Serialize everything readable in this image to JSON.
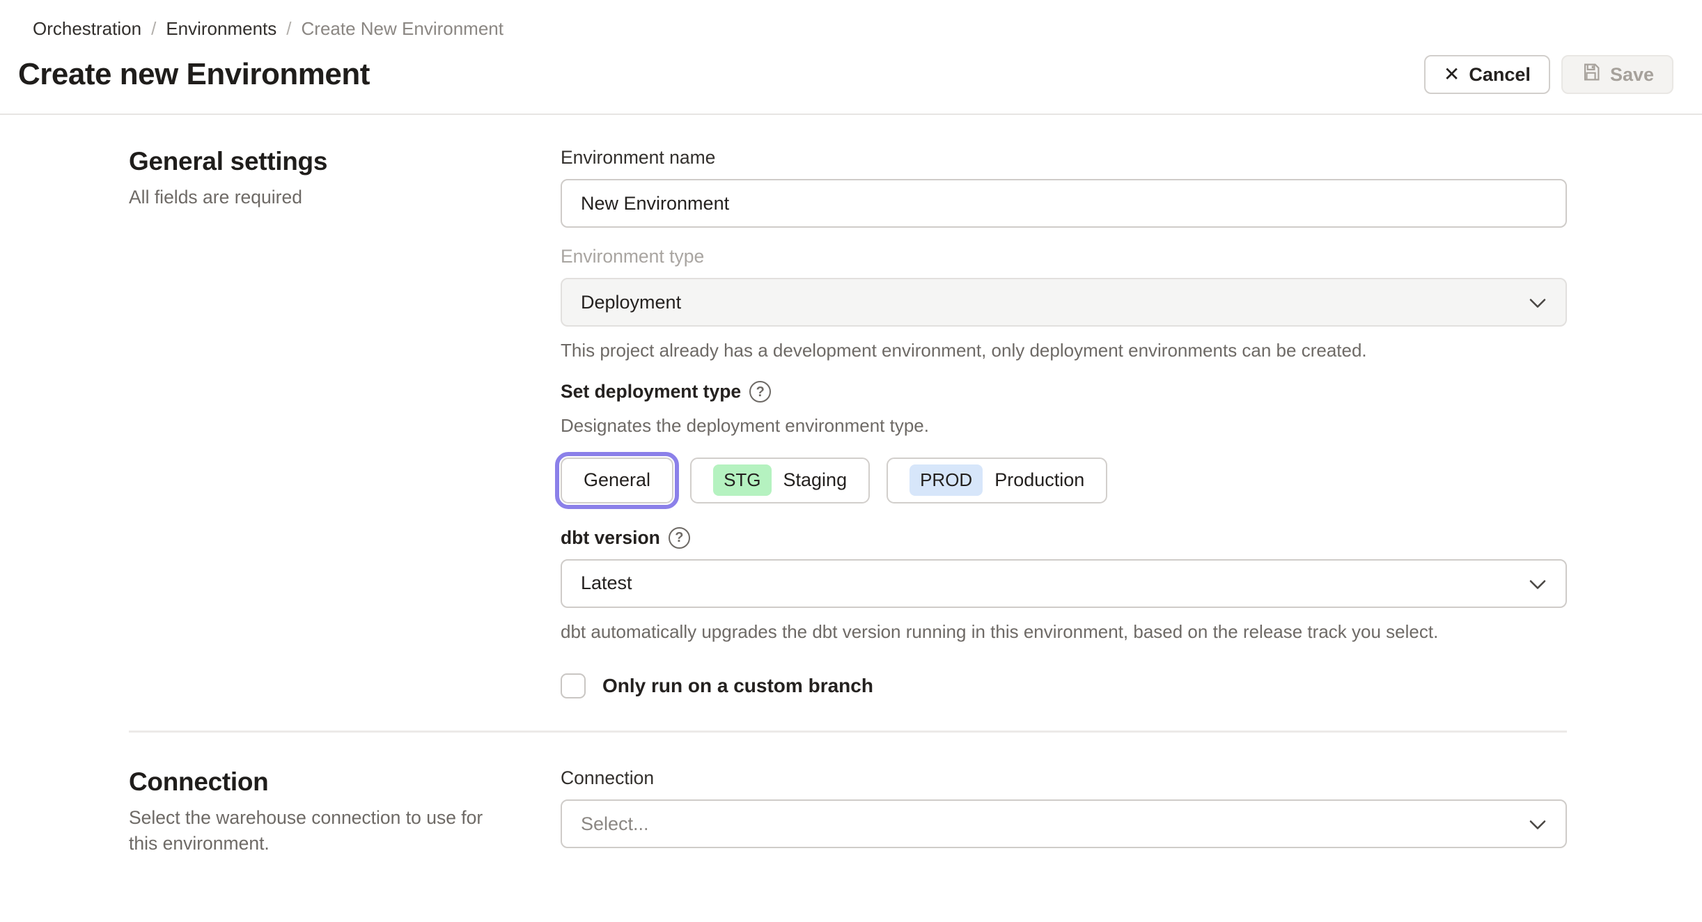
{
  "breadcrumb": {
    "separator": "/",
    "items": [
      {
        "label": "Orchestration"
      },
      {
        "label": "Environments"
      },
      {
        "label": "Create New Environment"
      }
    ]
  },
  "header": {
    "title": "Create new Environment",
    "cancel_label": "Cancel",
    "save_label": "Save"
  },
  "icons": {
    "close": "✕",
    "help": "?",
    "save": "floppy-disk-icon",
    "chevron_down": "chevron-down-icon"
  },
  "general": {
    "heading": "General settings",
    "subheading": "All fields are required",
    "environment_name": {
      "label": "Environment name",
      "value": "New Environment"
    },
    "environment_type": {
      "label": "Environment type",
      "value": "Deployment",
      "helper": "This project already has a development environment, only deployment environments can be created."
    },
    "deployment_type": {
      "label": "Set deployment type",
      "helper": "Designates the deployment environment type.",
      "options": [
        {
          "label": "General",
          "badge": "",
          "selected": true
        },
        {
          "label": "Staging",
          "badge": "STG",
          "selected": false
        },
        {
          "label": "Production",
          "badge": "PROD",
          "selected": false
        }
      ]
    },
    "dbt_version": {
      "label": "dbt version",
      "value": "Latest",
      "helper": "dbt automatically upgrades the dbt version running in this environment, based on the release track you select."
    },
    "custom_branch": {
      "label": "Only run on a custom branch",
      "checked": false
    }
  },
  "connection": {
    "heading": "Connection",
    "subheading": "Select the warehouse connection to use for this environment.",
    "field": {
      "label": "Connection",
      "placeholder": "Select..."
    }
  },
  "colors": {
    "accent_purple": "#8b80e9",
    "badge_staging_green": "#b5f2c0",
    "badge_production_blue": "#d7e6fa",
    "text_primary": "#24211f",
    "text_muted": "#6e6a66",
    "border": "#cfccc9"
  }
}
